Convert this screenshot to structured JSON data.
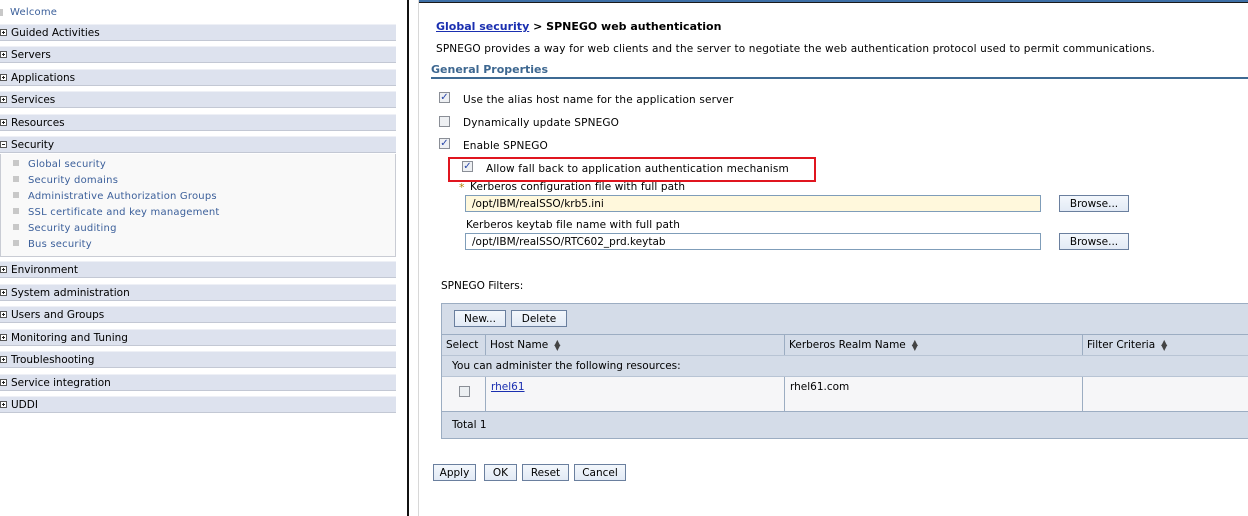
{
  "nav": {
    "welcome": "Welcome",
    "categories": [
      {
        "label": "Guided Activities",
        "expanded": false
      },
      {
        "label": "Servers",
        "expanded": false
      },
      {
        "label": "Applications",
        "expanded": false
      },
      {
        "label": "Services",
        "expanded": false
      },
      {
        "label": "Resources",
        "expanded": false
      },
      {
        "label": "Security",
        "expanded": true
      },
      {
        "label": "Environment",
        "expanded": false
      },
      {
        "label": "System administration",
        "expanded": false
      },
      {
        "label": "Users and Groups",
        "expanded": false
      },
      {
        "label": "Monitoring and Tuning",
        "expanded": false
      },
      {
        "label": "Troubleshooting",
        "expanded": false
      },
      {
        "label": "Service integration",
        "expanded": false
      },
      {
        "label": "UDDI",
        "expanded": false
      }
    ],
    "security_items": [
      "Global security",
      "Security domains",
      "Administrative Authorization Groups",
      "SSL certificate and key management",
      "Security auditing",
      "Bus security"
    ]
  },
  "main": {
    "breadcrumb_link": "Global security",
    "breadcrumb_sep": " > ",
    "breadcrumb_current": "SPNEGO web authentication",
    "description": "SPNEGO provides a way for web clients and the server to negotiate the web authentication protocol used to permit communications.",
    "section_title": "General Properties",
    "options": [
      {
        "label": "Use the alias host name for the application server",
        "checked": true
      },
      {
        "label": "Dynamically update SPNEGO",
        "checked": false
      },
      {
        "label": "Enable SPNEGO",
        "checked": true
      },
      {
        "label": "Allow fall back to application authentication mechanism",
        "checked": true
      }
    ],
    "required_marker": "*",
    "krb_config_label": "Kerberos configuration file with full path",
    "krb_config_value": "/opt/IBM/realSSO/krb5.ini",
    "keytab_label": "Kerberos keytab file name with full path",
    "keytab_value": "/opt/IBM/realSSO/RTC602_prd.keytab",
    "browse_label": "Browse...",
    "filters_label": "SPNEGO Filters:",
    "table": {
      "new_label": "New...",
      "delete_label": "Delete",
      "columns": [
        "Select",
        "Host Name",
        "Kerberos Realm Name",
        "Filter Criteria"
      ],
      "info": "You can administer the following resources:",
      "rows": [
        {
          "selected": false,
          "host": "rhel61",
          "realm": "rhel61.com",
          "criteria": ""
        }
      ],
      "total": "Total 1"
    },
    "buttons": {
      "apply": "Apply",
      "ok": "OK",
      "reset": "Reset",
      "cancel": "Cancel"
    }
  },
  "colors": {
    "highlight_box": "#e0151f",
    "section_title": "#3d6790",
    "link": "#1a2fb0"
  }
}
